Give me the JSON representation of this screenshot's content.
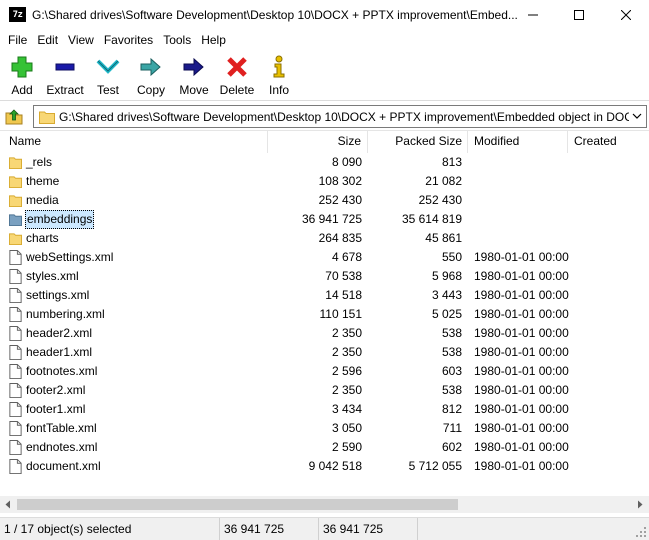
{
  "window": {
    "app_icon_text": "7z",
    "title": "G:\\Shared drives\\Software Development\\Desktop 10\\DOCX + PPTX improvement\\Embed...",
    "controls": [
      "minimize-icon",
      "maximize-icon",
      "close-icon"
    ]
  },
  "menu": [
    "File",
    "Edit",
    "View",
    "Favorites",
    "Tools",
    "Help"
  ],
  "toolbar": [
    {
      "label": "Add",
      "icon": "add-icon",
      "color": "#2eb82e"
    },
    {
      "label": "Extract",
      "icon": "extract-icon",
      "color": "#1a1aa8"
    },
    {
      "label": "Test",
      "icon": "test-icon",
      "color": "#1fb8c8"
    },
    {
      "label": "Copy",
      "icon": "copy-icon",
      "color": "#2a8a8a"
    },
    {
      "label": "Move",
      "icon": "move-icon",
      "color": "#1a1a8a"
    },
    {
      "label": "Delete",
      "icon": "delete-icon",
      "color": "#e02020"
    },
    {
      "label": "Info",
      "icon": "info-icon",
      "color": "#d4b000"
    }
  ],
  "address": {
    "path": "G:\\Shared drives\\Software Development\\Desktop 10\\DOCX + PPTX improvement\\Embedded object in DOC"
  },
  "columns": [
    "Name",
    "Size",
    "Packed Size",
    "Modified",
    "Created"
  ],
  "files": [
    {
      "name": "_rels",
      "type": "folder",
      "size": "8 090",
      "packed": "813",
      "modified": "",
      "selected": false
    },
    {
      "name": "theme",
      "type": "folder",
      "size": "108 302",
      "packed": "21 082",
      "modified": "",
      "selected": false
    },
    {
      "name": "media",
      "type": "folder",
      "size": "252 430",
      "packed": "252 430",
      "modified": "",
      "selected": false
    },
    {
      "name": "embeddings",
      "type": "folder",
      "size": "36 941 725",
      "packed": "35 614 819",
      "modified": "",
      "selected": true
    },
    {
      "name": "charts",
      "type": "folder",
      "size": "264 835",
      "packed": "45 861",
      "modified": "",
      "selected": false
    },
    {
      "name": "webSettings.xml",
      "type": "file",
      "size": "4 678",
      "packed": "550",
      "modified": "1980-01-01 00:00",
      "selected": false
    },
    {
      "name": "styles.xml",
      "type": "file",
      "size": "70 538",
      "packed": "5 968",
      "modified": "1980-01-01 00:00",
      "selected": false
    },
    {
      "name": "settings.xml",
      "type": "file",
      "size": "14 518",
      "packed": "3 443",
      "modified": "1980-01-01 00:00",
      "selected": false
    },
    {
      "name": "numbering.xml",
      "type": "file",
      "size": "110 151",
      "packed": "5 025",
      "modified": "1980-01-01 00:00",
      "selected": false
    },
    {
      "name": "header2.xml",
      "type": "file",
      "size": "2 350",
      "packed": "538",
      "modified": "1980-01-01 00:00",
      "selected": false
    },
    {
      "name": "header1.xml",
      "type": "file",
      "size": "2 350",
      "packed": "538",
      "modified": "1980-01-01 00:00",
      "selected": false
    },
    {
      "name": "footnotes.xml",
      "type": "file",
      "size": "2 596",
      "packed": "603",
      "modified": "1980-01-01 00:00",
      "selected": false
    },
    {
      "name": "footer2.xml",
      "type": "file",
      "size": "2 350",
      "packed": "538",
      "modified": "1980-01-01 00:00",
      "selected": false
    },
    {
      "name": "footer1.xml",
      "type": "file",
      "size": "3 434",
      "packed": "812",
      "modified": "1980-01-01 00:00",
      "selected": false
    },
    {
      "name": "fontTable.xml",
      "type": "file",
      "size": "3 050",
      "packed": "711",
      "modified": "1980-01-01 00:00",
      "selected": false
    },
    {
      "name": "endnotes.xml",
      "type": "file",
      "size": "2 590",
      "packed": "602",
      "modified": "1980-01-01 00:00",
      "selected": false
    },
    {
      "name": "document.xml",
      "type": "file",
      "size": "9 042 518",
      "packed": "5 712 055",
      "modified": "1980-01-01 00:00",
      "selected": false
    }
  ],
  "status": {
    "selection": "1 / 17 object(s) selected",
    "size": "36 941 725",
    "packed": "36 941 725"
  },
  "colors": {
    "selection_bg": "#cce8ff",
    "folder": "#f8d775"
  }
}
